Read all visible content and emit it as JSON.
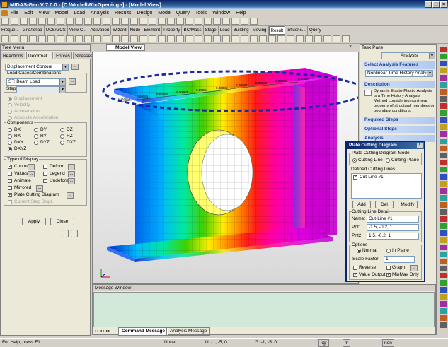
{
  "window": {
    "title": "MIDAS/Gen V 7.0.0 - [C:\\Model\\Wb-Opening •] - [Model View]"
  },
  "menu": [
    "File",
    "Edit",
    "View",
    "Model",
    "Load",
    "Analysis",
    "Results",
    "Design",
    "Mode",
    "Query",
    "Tools",
    "Window",
    "Help"
  ],
  "tabs": [
    "Freque...",
    "Grid/Snap",
    "UCS/GCS",
    "View C...",
    "Activation",
    "Wizard",
    "Node",
    "Element",
    "Property",
    "BC/Mass",
    "Stage",
    "Load",
    "Building",
    "Moving",
    "Result",
    "Influenc...",
    "Query"
  ],
  "active_tab": "Result",
  "tree": {
    "header": "Tree Menu",
    "tabs": [
      "Reactions",
      "Deformat...",
      "Forces",
      "Stresses"
    ],
    "active_tab": "Deformat...",
    "type_select": "Displacement Contour",
    "load_cases_label": "Load Cases/Combinations",
    "load_case": "ST: Beam Load",
    "step_label": "Step",
    "modes": [
      {
        "label": "Displacement",
        "on": true
      },
      {
        "label": "Velocity",
        "on": false
      },
      {
        "label": "Acceleration",
        "on": false
      },
      {
        "label": "Absolute Acceleration",
        "on": false
      }
    ],
    "components_label": "Components",
    "components": [
      "DX",
      "DY",
      "DZ",
      "RX",
      "RY",
      "RZ",
      "DXY",
      "DYZ",
      "DXZ",
      "DXYZ"
    ],
    "selected_component": "DXYZ",
    "type_of_display_label": "Type of Display",
    "display": [
      {
        "label": "Contour",
        "checked": true
      },
      {
        "label": "Deform",
        "checked": false
      },
      {
        "label": "Values",
        "checked": false
      },
      {
        "label": "Legend",
        "checked": false
      },
      {
        "label": "Animate",
        "checked": false
      },
      {
        "label": "Undeformed",
        "checked": false
      },
      {
        "label": "Mirrored",
        "checked": false
      },
      {
        "label": "Plate Cutting Diagram",
        "checked": true
      },
      {
        "label": "Current Step Displ.",
        "checked": false
      }
    ],
    "apply_label": "Apply",
    "close_label": "Close"
  },
  "model_view": {
    "tab_label": "Model View",
    "value_labels": [
      "0.00081",
      "0.00085",
      "0.00080",
      "0.00082",
      "0.00084",
      "0.00086",
      "0.00087",
      "0.00083",
      "0.00085",
      "0.00084"
    ]
  },
  "task_pane": {
    "header": "Task Pane",
    "title": "Analysis",
    "select_features_label": "Select Analysis Features",
    "feature": "Nonlinear Time History Analysis",
    "description_label": "Description",
    "description": "Dynamic Elasto-Plastic Analysis is a Time History Analysis Method considering nonlinear property of structural members or boundary conditions.",
    "required_steps": "Required Steps",
    "optional_steps": "Optional Steps",
    "analysis": "Analysis"
  },
  "dialog": {
    "title": "Plate Cutting Diagram",
    "mode_label": "Plate Cutting Diagram Mode",
    "mode_line": "Cutting Line",
    "mode_plane": "Cutting Plane",
    "defined_label": "Defined Cutting Lines",
    "lines": [
      "Cut-Line #1"
    ],
    "add": "Add",
    "del": "Del",
    "modify": "Modify",
    "detail_label": "Cutting Line Detail",
    "name_label": "Name:",
    "name_value": "Cut-Line #1",
    "pnt1_label": "Pnt1:",
    "pnt1_value": "-1.5, -0.2, 1",
    "pnt2_label": "Pnt2:",
    "pnt2_value": "1.5, -0.2, 1",
    "options_label": "Options",
    "normal": "Normal",
    "inplane": "In Plane",
    "scale_label": "Scale Factor:",
    "scale_value": "1",
    "reverse": "Reverse",
    "graph": "Graph",
    "value_output": "Value Output",
    "minmax": "MinMax Only"
  },
  "message": {
    "header": "Message Window",
    "tabs": [
      "Command Message",
      "Analysis Message"
    ]
  },
  "status": {
    "help": "For Help, press F1",
    "none": "None!",
    "u": "U: -1, -5, 0",
    "g": "G: -1, -5, 0",
    "unit_force": "kgf",
    "unit_len": "m",
    "none2": "non"
  },
  "colors": {
    "accent": "#0a246a",
    "dashed": "#1a2aa0",
    "contour": [
      "#0000cc",
      "#00aaff",
      "#00e0a0",
      "#33cc00",
      "#ccff00",
      "#ffcc00",
      "#ff6600",
      "#ff2200",
      "#ff00aa",
      "#dd00dd"
    ]
  }
}
